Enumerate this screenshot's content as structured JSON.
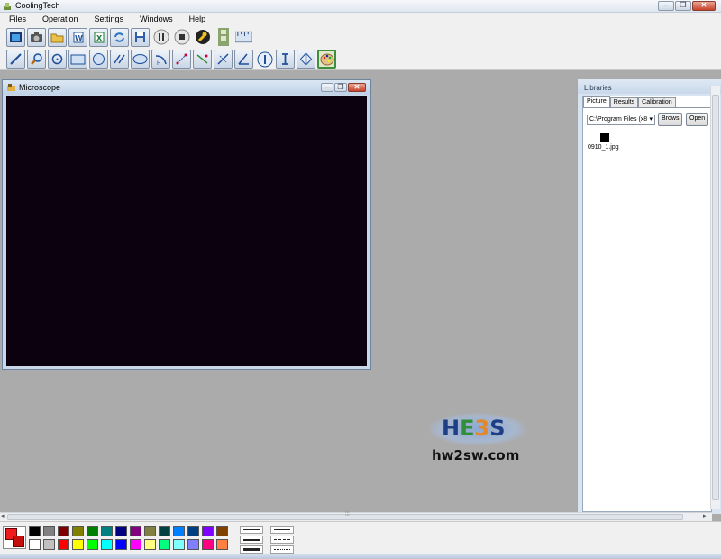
{
  "window": {
    "title": "CoolingTech"
  },
  "menu": [
    "Files",
    "Operation",
    "Settings",
    "Windows",
    "Help"
  ],
  "toolbar1": [
    {
      "name": "video-capture-icon"
    },
    {
      "name": "camera-icon"
    },
    {
      "name": "open-folder-icon"
    },
    {
      "name": "word-export-icon"
    },
    {
      "name": "excel-export-icon"
    },
    {
      "name": "refresh-icon"
    },
    {
      "name": "save-icon"
    },
    {
      "name": "pause-icon"
    },
    {
      "name": "stop-icon"
    },
    {
      "name": "wrench-icon"
    },
    {
      "name": "film-strip-icon"
    },
    {
      "name": "ruler-icon"
    }
  ],
  "toolbar2": [
    {
      "name": "line-tool-icon"
    },
    {
      "name": "zoom-icon"
    },
    {
      "name": "circle-select-icon"
    },
    {
      "name": "rectangle-tool-icon"
    },
    {
      "name": "circle-tool-icon"
    },
    {
      "name": "parallel-lines-icon"
    },
    {
      "name": "ellipse-tool-icon"
    },
    {
      "name": "arc-tool-icon"
    },
    {
      "name": "point-distance-icon"
    },
    {
      "name": "line-angle-icon"
    },
    {
      "name": "perpendicular-icon"
    },
    {
      "name": "angle-tool-icon"
    },
    {
      "name": "vertical-measure-icon"
    },
    {
      "name": "text-cursor-icon"
    },
    {
      "name": "diamond-measure-icon"
    },
    {
      "name": "color-palette-icon"
    }
  ],
  "microscope": {
    "title": "Microscope"
  },
  "libraries": {
    "title": "Libraries",
    "tabs": [
      "Picture",
      "Results",
      "Calibration"
    ],
    "path": "C:\\Program Files (x8",
    "browse_label": "Brows",
    "open_label": "Open",
    "files": [
      "0910_1.jpg"
    ]
  },
  "watermark": {
    "url": "hw2sw.com"
  },
  "colors": {
    "foreground": "#ee1c1c",
    "background": "#c40e0e",
    "palette_row1": [
      "#000000",
      "#808080",
      "#800000",
      "#808000",
      "#008000",
      "#008080",
      "#000080",
      "#800080",
      "#808040",
      "#004040",
      "#0080ff",
      "#004080",
      "#8000ff",
      "#804000"
    ],
    "palette_row2": [
      "#ffffff",
      "#c0c0c0",
      "#ff0000",
      "#ffff00",
      "#00ff00",
      "#00ffff",
      "#0000ff",
      "#ff00ff",
      "#ffff80",
      "#00ff80",
      "#80ffff",
      "#8080ff",
      "#ff0080",
      "#ff8040"
    ]
  }
}
